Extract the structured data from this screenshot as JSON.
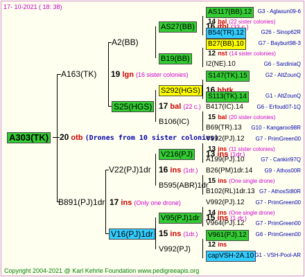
{
  "header": "17- 10-2021 ( 18: 38)",
  "footer": "Copyright 2004-2021 @ Karl Kehrle Foundation     www.pedigreeapis.org",
  "root": {
    "id": "A303(TK)",
    "year": "20",
    "code": "otb",
    "note": "(Drones from 10 sister colonies)"
  },
  "gen1": [
    {
      "id": "A163(TK)",
      "year": "19",
      "code": "lgn",
      "note": "(16 sister colonies)"
    },
    {
      "id": "B891(PJ)1dr",
      "year": "17",
      "code": "ins",
      "note": "(Only one drone)"
    }
  ],
  "gen2": [
    {
      "id": "A2(BB)"
    },
    {
      "id": "S25(HGS)",
      "year": "17",
      "code": "bal",
      "note": "(22 c.)"
    },
    {
      "id": "V22(PJ)1dr",
      "year": "16",
      "code": "ins",
      "note": "(1dr.)"
    },
    {
      "id": "V16(PJ)1dr",
      "year": "15",
      "code": "ins",
      "note": "(1dr.)"
    }
  ],
  "gen3": [
    {
      "id": "AS27(BB)",
      "year": "16",
      "code": "ithl",
      "note": "(33 c.)"
    },
    {
      "id": "B19(BB)"
    },
    {
      "id": "S292(HGS)",
      "year": "16",
      "code": "hbtk"
    },
    {
      "id": "B106(IC)"
    },
    {
      "id": "V216(PJ)",
      "year": "13",
      "code": "ins",
      "note": "(1dr.)"
    },
    {
      "id": "B595(ABR)1dr"
    },
    {
      "id": "V95(PJ)1dr",
      "year": "15",
      "code": "ins",
      "note": "(1 dr.)"
    },
    {
      "id": "V992(PJ)"
    }
  ],
  "gen4": [
    {
      "id": "AS117(BB).12",
      "right": "G3 - Aglasun09-6",
      "year": "14",
      "code": "bal",
      "note": "(22 sister colonies)"
    },
    {
      "id": "B54(TR).12",
      "right": "G26 - Sinop62R"
    },
    {
      "id": "B27(BB).10",
      "right": "G7 - Bayburt98-3",
      "year": "12",
      "code": "nst",
      "note": "(14 sister colonies)"
    },
    {
      "id": "I2(NE).10",
      "right": "G6 - SardiniaQ"
    },
    {
      "id": "S147(TK).15",
      "right": "G2 - AltZounQ"
    },
    {
      "id": "S113(TK).14",
      "right": "G1 - AltZounQ"
    },
    {
      "id": "B417(IC).14",
      "right": "G6 - Erfoud07-1Q",
      "year": "15",
      "code": "bal",
      "note": "(20 sister colonies)"
    },
    {
      "id": "B69(TR).13",
      "right": "G10 - Kangaroo98R"
    },
    {
      "id": "V992(PJ).12",
      "right": "G7 - PrimGreen00",
      "year": "13",
      "code": "ins",
      "note": "(11 sister colonies)"
    },
    {
      "id": "A199(PJ).10",
      "right": "G7 - Cankiri97Q"
    },
    {
      "id": "B26(PM)1dr.14",
      "right": "G9 - Athos00R",
      "year": "15",
      "code": "ins",
      "note": "(One single drone)"
    },
    {
      "id": "B102(RL)1dr.13",
      "right": "G7 - AthosSt80R"
    },
    {
      "id": "V992(PJ).12",
      "right": "G7 - PrimGreen00",
      "year": "14",
      "code": "ins",
      "note": "(One single drone)"
    },
    {
      "id": "V964(PJ).12",
      "right": "G7 - PrimGreen00"
    },
    {
      "id": "V961(PJ).12",
      "right": "G6 - PrimGreen00",
      "year": "12",
      "code": "ins"
    },
    {
      "id": "capVSH-2A.10",
      "right": "G1 - VSH-Pool-AR"
    }
  ]
}
